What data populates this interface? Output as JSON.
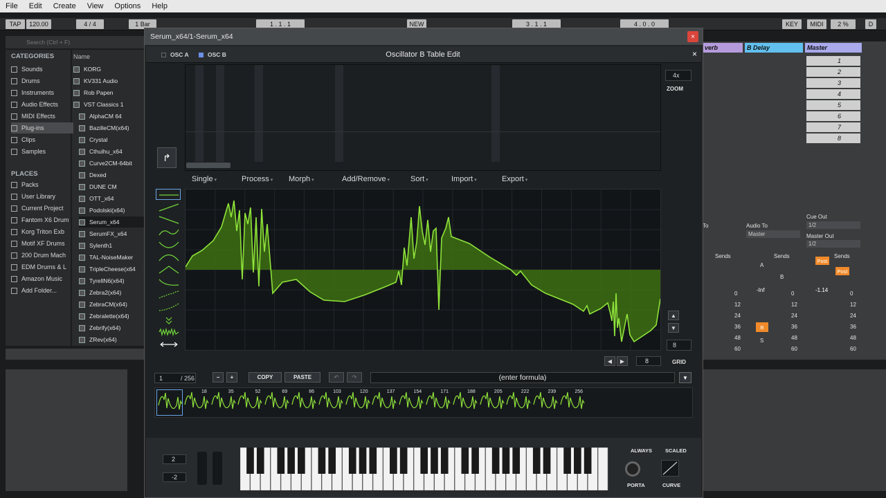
{
  "menu": [
    "File",
    "Edit",
    "Create",
    "View",
    "Options",
    "Help"
  ],
  "transport": {
    "tap": "TAP",
    "tempo": "120.00",
    "sig": "4 / 4",
    "quant": "1 Bar",
    "pos": "1 . 1 . 1",
    "new": "NEW",
    "end_pos": "3 . 1 . 1",
    "loop": "4 . 0 . 0",
    "key": "KEY",
    "midi": "MIDI",
    "cpu": "2 %",
    "d": "D"
  },
  "browser": {
    "search_placeholder": "Search (Ctrl + F)",
    "categories_title": "CATEGORIES",
    "name_header": "Name",
    "categories": [
      "Sounds",
      "Drums",
      "Instruments",
      "Audio Effects",
      "MIDI Effects",
      "Plug-ins",
      "Clips",
      "Samples"
    ],
    "places_title": "PLACES",
    "places": [
      "Packs",
      "User Library",
      "Current Project",
      "Fantom X6 Drum",
      "Korg Triton Exb",
      "Motif XF Drums",
      "200 Drum Mach",
      "EDM Drums & L",
      "Amazon Music",
      "Add Folder..."
    ],
    "items": [
      "KORG",
      "KV331 Audio",
      "Rob Papen",
      "VST Classics 1",
      "AlphaCM 64",
      "BazilleCM(x64)",
      "Crystal",
      "Cthulhu_x64",
      "Curve2CM-64bit",
      "Dexed",
      "DUNE CM",
      "OTT_x64",
      "Podolski(x64)",
      "Serum_x64",
      "SerumFX_x64",
      "Sylenth1",
      "TAL-NoiseMaker",
      "TripleCheese(x64",
      "TyrellN6(x64)",
      "Zebra2(x64)",
      "ZebraCM(x64)",
      "Zebralette(x64)",
      "Zebrify(x64)",
      "ZRev(x64)"
    ]
  },
  "mixer": {
    "headers": [
      "verb",
      "B Delay",
      "Master"
    ],
    "scene_numbers": [
      "1",
      "2",
      "3",
      "4",
      "5",
      "6",
      "7",
      "8"
    ],
    "audio_to": "Audio To",
    "to": "To",
    "audio_to_val": "Master",
    "cue_out": "Cue Out",
    "cue_val": "1/2",
    "master_out": "Master Out",
    "master_val": "1/2",
    "sends": "Sends",
    "post": "Post",
    "inf": "-Inf",
    "vol": "-1.14",
    "db": [
      "0",
      "12",
      "24",
      "36",
      "48",
      "60"
    ],
    "b": "B",
    "s": "S",
    "a": "A"
  },
  "plugin": {
    "window_title": "Serum_x64/1-Serum_x64",
    "close": "×",
    "osc_a": "OSC A",
    "osc_b": "OSC B",
    "editor_title": "Oscillator B Table Edit",
    "zoom_val": "4x",
    "zoom_label": "ZOOM",
    "menu": [
      "Single",
      "Process",
      "Morph",
      "Add/Remove",
      "Sort",
      "Import",
      "Export"
    ],
    "grid_val": "8",
    "grid_label": "GRID",
    "grid_val2": "8",
    "frame_val": "1",
    "frame_total": "/ 256",
    "copy": "COPY",
    "paste": "PASTE",
    "formula": "(enter formula)",
    "frames": [
      "",
      "18",
      "35",
      "52",
      "69",
      "86",
      "103",
      "120",
      "137",
      "154",
      "171",
      "188",
      "205",
      "222",
      "239",
      "256"
    ],
    "keyboard": {
      "oct_up": "2",
      "oct_dn": "-2",
      "always": "ALWAYS",
      "scaled": "SCALED",
      "porta": "PORTA",
      "curve": "CURVE"
    }
  },
  "colors": {
    "wave": "#8fe33a",
    "fill": "#3d6f12",
    "accent": "#f08a2a"
  }
}
